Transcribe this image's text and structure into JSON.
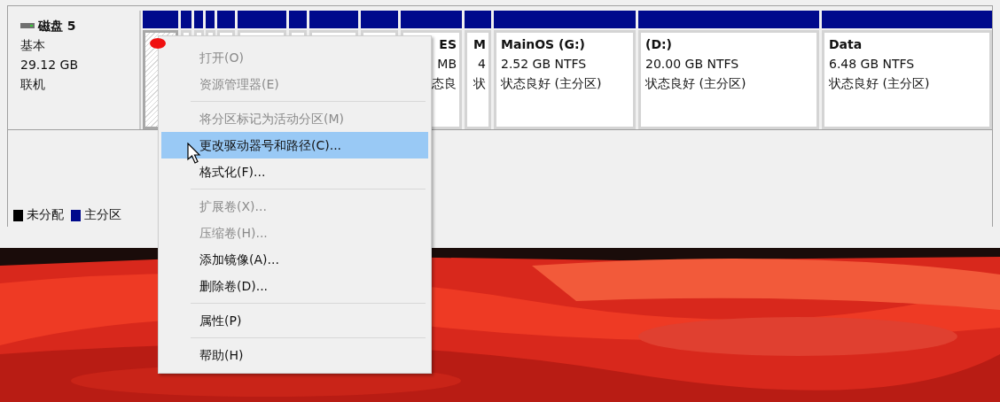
{
  "disk": {
    "name": "磁盘 5",
    "type": "基本",
    "size": "29.12 GB",
    "status": "联机"
  },
  "partitions": [
    {
      "kind": "hatched",
      "selected": true
    },
    {
      "kind": "hidden",
      "selected": false
    },
    {
      "kind": "hidden",
      "selected": false
    },
    {
      "kind": "hidden",
      "selected": false
    },
    {
      "kind": "hidden",
      "selected": false
    },
    {
      "kind": "hidden",
      "selected": false
    },
    {
      "kind": "hidden",
      "selected": false
    },
    {
      "kind": "hidden",
      "selected": false
    },
    {
      "kind": "hidden",
      "selected": false
    },
    {
      "kind": "covered",
      "selected": false,
      "name": "ES",
      "size": "MB",
      "status": "态良"
    },
    {
      "kind": "covered",
      "selected": false,
      "name": "M",
      "size": "4",
      "status": "状"
    },
    {
      "kind": "volume",
      "selected": false,
      "name": "MainOS  (G:)",
      "size": "2.52 GB NTFS",
      "status": "状态良好 (主分区)"
    },
    {
      "kind": "volume",
      "selected": false,
      "name": "(D:)",
      "size": "20.00 GB NTFS",
      "status": "状态良好 (主分区)"
    },
    {
      "kind": "volume",
      "selected": false,
      "name": "Data",
      "size": "6.48 GB NTFS",
      "status": "状态良好 (主分区)"
    }
  ],
  "legend": [
    {
      "label": "未分配",
      "color": "#000000"
    },
    {
      "label": "主分区",
      "color": "#000a8c"
    }
  ],
  "context_menu": [
    {
      "kind": "item",
      "label": "打开(O)",
      "disabled": true,
      "selected": false
    },
    {
      "kind": "item",
      "label": "资源管理器(E)",
      "disabled": true,
      "selected": false
    },
    {
      "kind": "separator"
    },
    {
      "kind": "item",
      "label": "将分区标记为活动分区(M)",
      "disabled": true,
      "selected": false
    },
    {
      "kind": "item",
      "label": "更改驱动器号和路径(C)...",
      "disabled": false,
      "selected": true
    },
    {
      "kind": "item",
      "label": "格式化(F)...",
      "disabled": false,
      "selected": false
    },
    {
      "kind": "separator"
    },
    {
      "kind": "item",
      "label": "扩展卷(X)...",
      "disabled": true,
      "selected": false
    },
    {
      "kind": "item",
      "label": "压缩卷(H)...",
      "disabled": true,
      "selected": false
    },
    {
      "kind": "item",
      "label": "添加镜像(A)...",
      "disabled": false,
      "selected": false
    },
    {
      "kind": "item",
      "label": "删除卷(D)...",
      "disabled": false,
      "selected": false
    },
    {
      "kind": "separator"
    },
    {
      "kind": "item",
      "label": "属性(P)",
      "disabled": false,
      "selected": false
    },
    {
      "kind": "separator"
    },
    {
      "kind": "item",
      "label": "帮助(H)",
      "disabled": false,
      "selected": false
    }
  ]
}
